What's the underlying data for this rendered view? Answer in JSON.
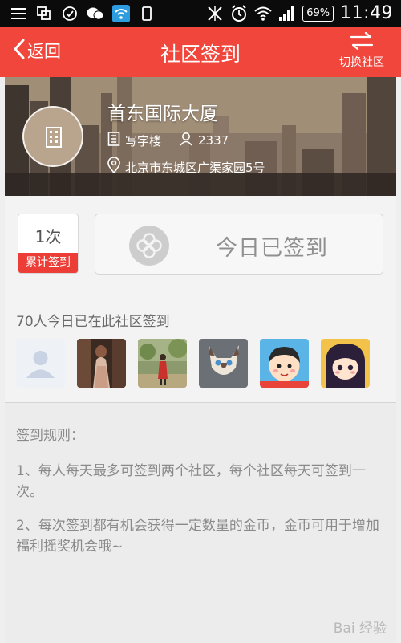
{
  "status_bar": {
    "battery": "69%",
    "time": "11:49"
  },
  "nav": {
    "back_label": "返回",
    "title": "社区签到",
    "switch_label": "切换社区"
  },
  "community": {
    "name": "首东国际大厦",
    "type": "写字楼",
    "members": "2337",
    "address": "北京市东城区广渠家园5号"
  },
  "checkin": {
    "count": "1次",
    "count_label": "累计签到",
    "button_label": "今日已签到"
  },
  "visitors": {
    "title": "70人今日已在此社区签到",
    "avatars": [
      "default-user",
      "woman-in-dress",
      "woman-in-red-coat",
      "siamese-cat",
      "cartoon-girl",
      "cartoon-girl-dark-hair"
    ]
  },
  "rules": {
    "title": "签到规则：",
    "items": [
      "1、每人每天最多可签到两个社区，每个社区每天可签到一次。",
      "2、每次签到都有机会获得一定数量的金币，金币可用于增加福利摇奖机会哦~"
    ]
  },
  "colors": {
    "accent": "#f0463c",
    "badge": "#ec3e36",
    "status_bar": "#0b0b0b"
  },
  "watermark": {
    "text": "Bai 经验"
  }
}
